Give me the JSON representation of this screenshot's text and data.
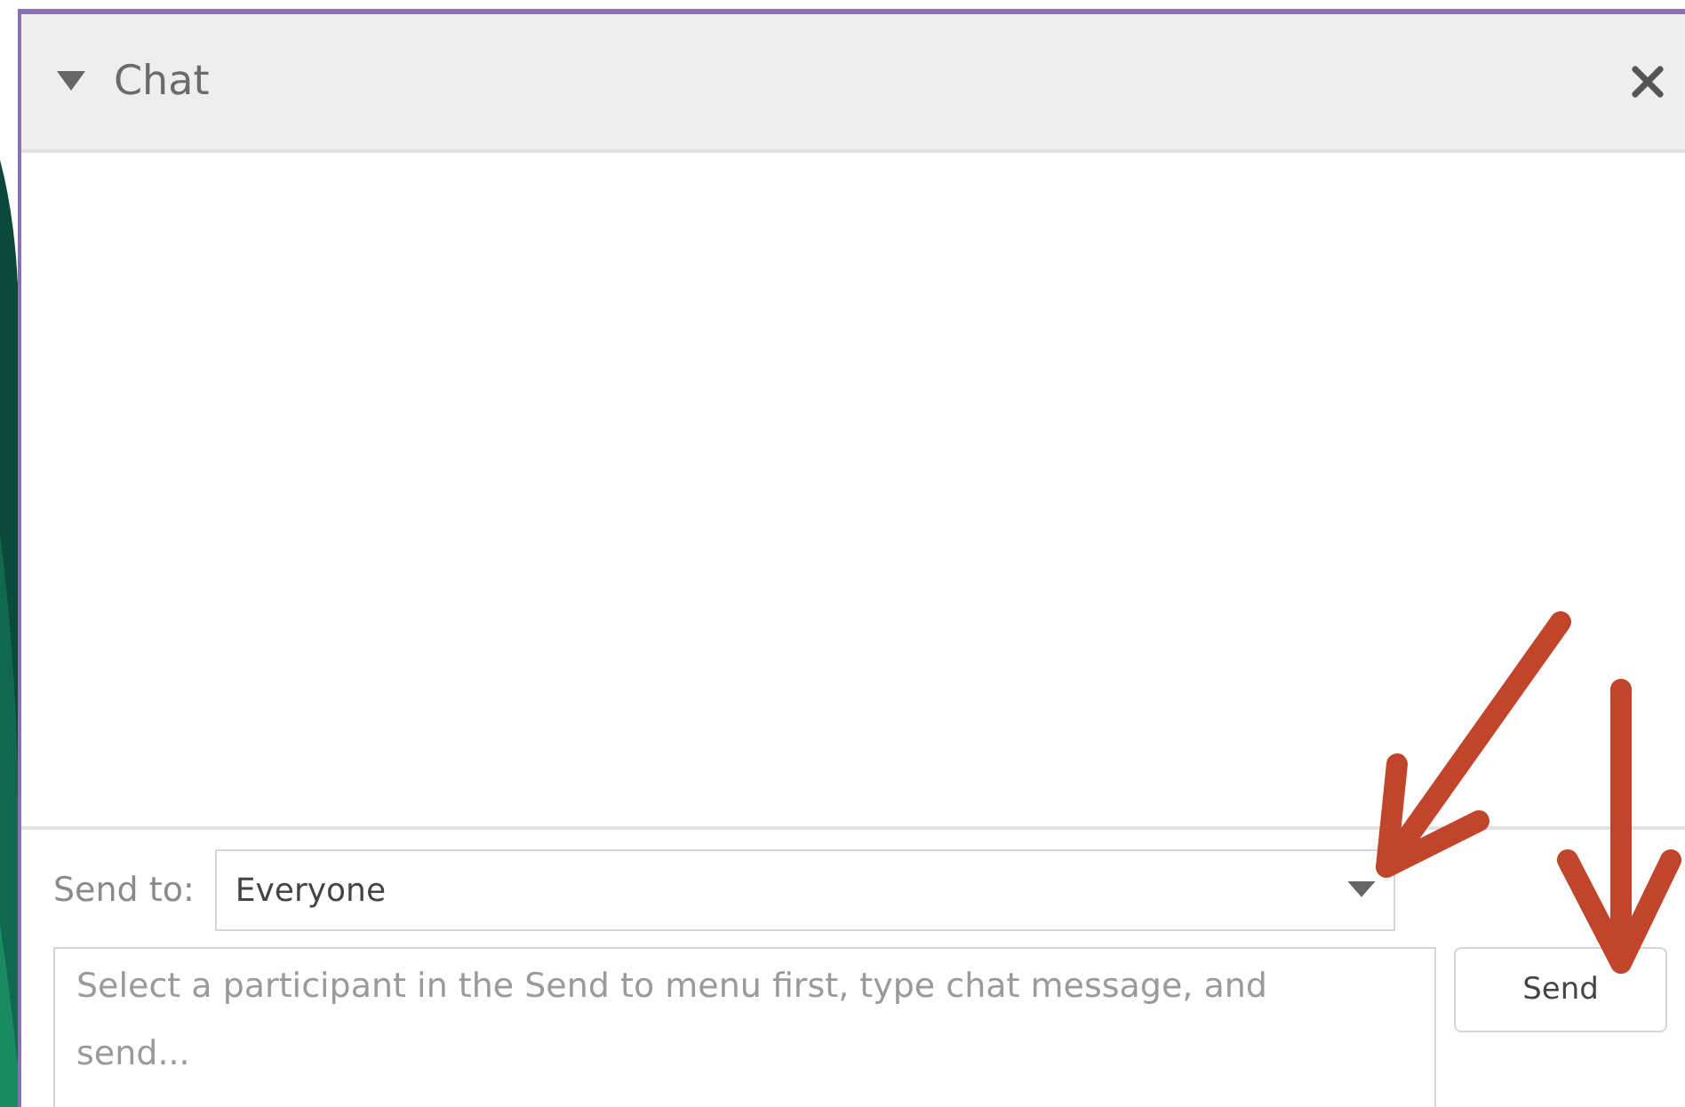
{
  "panel": {
    "title": "Chat",
    "expanded": true
  },
  "send_to": {
    "label": "Send to:",
    "value": "Everyone"
  },
  "message": {
    "placeholder": "Select a participant in the Send to menu first, type chat message, and send..."
  },
  "send_button": {
    "label": "Send"
  }
}
